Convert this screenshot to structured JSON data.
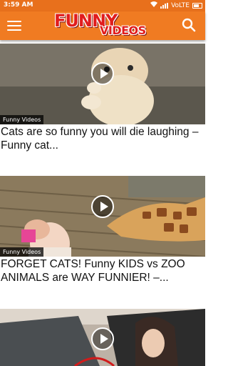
{
  "status_bar": {
    "time": "3:59 AM",
    "network": "VoLTE",
    "icons": [
      "mail-icon",
      "alarm-icon",
      "wifi-icon",
      "signal-icon",
      "battery-icon"
    ]
  },
  "app_bar": {
    "logo_line1": "FUNNY",
    "logo_line2": "VIDEOS",
    "menu_icon": "hamburger-menu-icon",
    "search_icon": "search-icon"
  },
  "colors": {
    "app_bar": "#f07b22",
    "status_bar": "#e8701c",
    "logo_text": "#e11d1d"
  },
  "videos": [
    {
      "channel": "Funny Videos",
      "title": "Cats are so funny you will die laughing – Funny cat...",
      "thumbnail": "cat-photo"
    },
    {
      "channel": "Funny Videos",
      "title": "FORGET CATS! Funny KIDS vs ZOO ANIMALS are WAY FUNNIER! –...",
      "thumbnail": "girl-and-giraffe-photo"
    },
    {
      "channel": "",
      "title": "",
      "thumbnail": "woman-in-car-photo"
    }
  ]
}
